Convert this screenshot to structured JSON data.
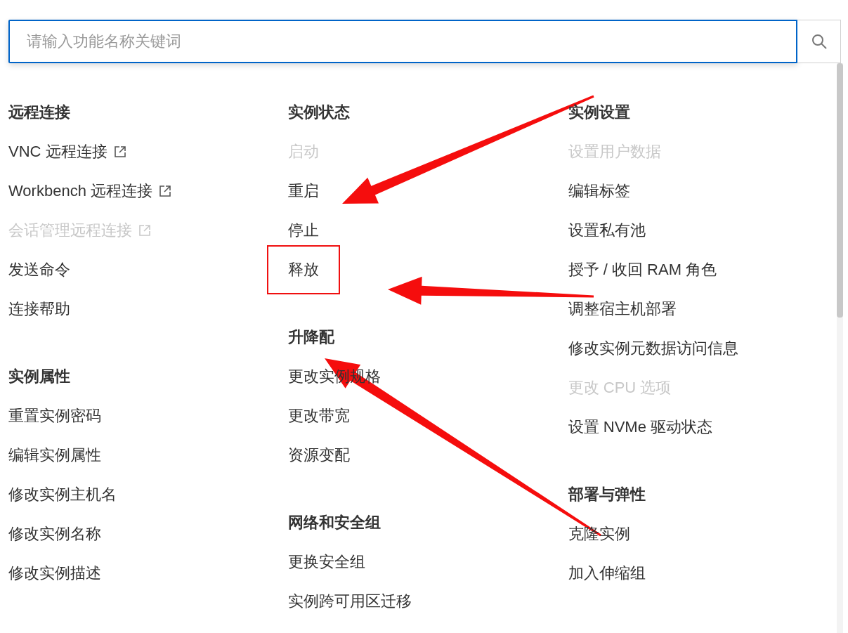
{
  "search": {
    "placeholder": "请输入功能名称关键词"
  },
  "columns": [
    {
      "groups": [
        {
          "title": "远程连接",
          "items": [
            {
              "label": "VNC 远程连接",
              "external": true,
              "disabled": false,
              "highlighted": false
            },
            {
              "label": "Workbench 远程连接",
              "external": true,
              "disabled": false,
              "highlighted": false
            },
            {
              "label": "会话管理远程连接",
              "external": true,
              "disabled": true,
              "highlighted": false
            },
            {
              "label": "发送命令",
              "external": false,
              "disabled": false,
              "highlighted": false
            },
            {
              "label": "连接帮助",
              "external": false,
              "disabled": false,
              "highlighted": false
            }
          ]
        },
        {
          "title": "实例属性",
          "items": [
            {
              "label": "重置实例密码",
              "external": false,
              "disabled": false,
              "highlighted": false
            },
            {
              "label": "编辑实例属性",
              "external": false,
              "disabled": false,
              "highlighted": false
            },
            {
              "label": "修改实例主机名",
              "external": false,
              "disabled": false,
              "highlighted": false
            },
            {
              "label": "修改实例名称",
              "external": false,
              "disabled": false,
              "highlighted": false
            },
            {
              "label": "修改实例描述",
              "external": false,
              "disabled": false,
              "highlighted": false
            }
          ]
        }
      ]
    },
    {
      "groups": [
        {
          "title": "实例状态",
          "items": [
            {
              "label": "启动",
              "external": false,
              "disabled": true,
              "highlighted": false
            },
            {
              "label": "重启",
              "external": false,
              "disabled": false,
              "highlighted": false
            },
            {
              "label": "停止",
              "external": false,
              "disabled": false,
              "highlighted": false
            },
            {
              "label": "释放",
              "external": false,
              "disabled": false,
              "highlighted": true
            }
          ]
        },
        {
          "title": "升降配",
          "items": [
            {
              "label": "更改实例规格",
              "external": false,
              "disabled": false,
              "highlighted": false
            },
            {
              "label": "更改带宽",
              "external": false,
              "disabled": false,
              "highlighted": false
            },
            {
              "label": "资源变配",
              "external": false,
              "disabled": false,
              "highlighted": false
            }
          ]
        },
        {
          "title": "网络和安全组",
          "items": [
            {
              "label": "更换安全组",
              "external": false,
              "disabled": false,
              "highlighted": false
            },
            {
              "label": "实例跨可用区迁移",
              "external": false,
              "disabled": false,
              "highlighted": false
            }
          ]
        }
      ]
    },
    {
      "groups": [
        {
          "title": "实例设置",
          "items": [
            {
              "label": "设置用户数据",
              "external": false,
              "disabled": true,
              "highlighted": false
            },
            {
              "label": "编辑标签",
              "external": false,
              "disabled": false,
              "highlighted": false
            },
            {
              "label": "设置私有池",
              "external": false,
              "disabled": false,
              "highlighted": false
            },
            {
              "label": "授予 / 收回 RAM 角色",
              "external": false,
              "disabled": false,
              "highlighted": false
            },
            {
              "label": "调整宿主机部署",
              "external": false,
              "disabled": false,
              "highlighted": false
            },
            {
              "label": "修改实例元数据访问信息",
              "external": false,
              "disabled": false,
              "highlighted": false
            },
            {
              "label": "更改 CPU 选项",
              "external": false,
              "disabled": true,
              "highlighted": false
            },
            {
              "label": "设置 NVMe 驱动状态",
              "external": false,
              "disabled": false,
              "highlighted": false
            }
          ]
        },
        {
          "title": "部署与弹性",
          "items": [
            {
              "label": "克隆实例",
              "external": false,
              "disabled": false,
              "highlighted": false
            },
            {
              "label": "加入伸缩组",
              "external": false,
              "disabled": false,
              "highlighted": false
            }
          ]
        }
      ]
    }
  ]
}
